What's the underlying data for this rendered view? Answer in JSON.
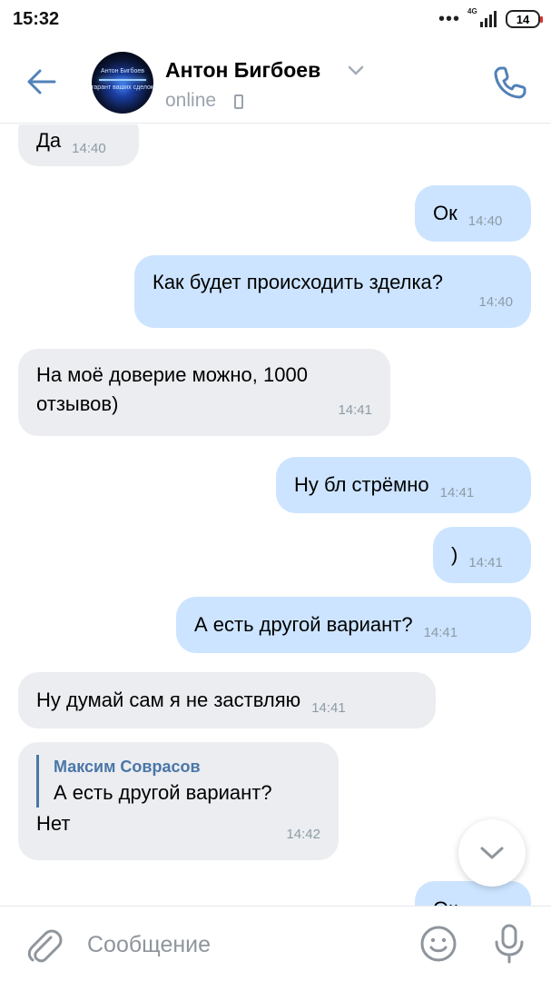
{
  "status_bar": {
    "time": "15:32",
    "network": "4G",
    "battery": "14"
  },
  "header": {
    "contact_name": "Антон Бигбоев",
    "status": "online",
    "avatar_text_line1": "Антон Бигбоев",
    "avatar_text_line2": "гарант ваших сделок"
  },
  "messages": [
    {
      "direction": "in",
      "text": "Да",
      "time": "14:40"
    },
    {
      "direction": "out",
      "text": "Ок",
      "time": "14:40"
    },
    {
      "direction": "out",
      "text": "Как будет происходить зделка?",
      "time": "14:40"
    },
    {
      "direction": "in",
      "text": "На моё доверие можно, 1000 отзывов)",
      "time": "14:41"
    },
    {
      "direction": "out",
      "text": "Ну бл стрёмно",
      "time": "14:41"
    },
    {
      "direction": "out",
      "text": ")",
      "time": "14:41"
    },
    {
      "direction": "out",
      "text": "А есть другой вариант?",
      "time": "14:41"
    },
    {
      "direction": "in",
      "text": "Ну думай сам я не заствляю",
      "time": "14:41"
    },
    {
      "direction": "in",
      "text": "Нет",
      "time": "14:42",
      "reply": {
        "author": "Максим Соврасов",
        "text": "А есть другой вариант?"
      }
    },
    {
      "direction": "out",
      "text": "Ок",
      "time": ""
    }
  ],
  "composer": {
    "placeholder": "Сообщение"
  },
  "colors": {
    "accent": "#4a76a8",
    "outgoing_bubble": "#cce4ff",
    "incoming_bubble": "#ebedf0",
    "icon_blue": "#5181b8",
    "icon_gray": "#8f959c"
  },
  "icons": {
    "back": "arrow-left-icon",
    "call": "phone-icon",
    "attach": "paperclip-icon",
    "emoji": "smile-icon",
    "voice": "microphone-icon",
    "scroll": "chevron-down-icon"
  }
}
